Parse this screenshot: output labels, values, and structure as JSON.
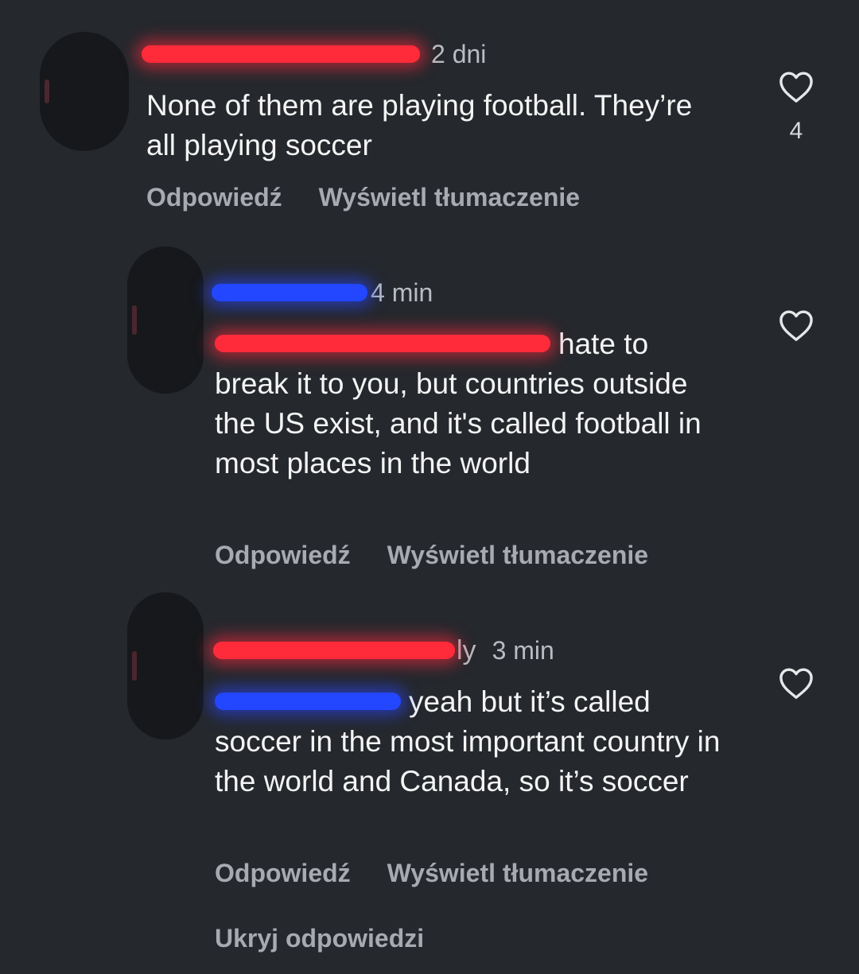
{
  "comments": [
    {
      "username_redacted": true,
      "time": "2 dni",
      "text": "None of them are playing football. They’re all playing soccer",
      "reply_label": "Odpowiedź",
      "translate_label": "Wyświetl tłumaczenie",
      "likes": "4"
    },
    {
      "username_redacted": true,
      "time": "4 min",
      "mention_redacted": true,
      "text": "hate to break it to you, but countries outside the US exist, and it's called football in most places in the world",
      "reply_label": "Odpowiedź",
      "translate_label": "Wyświetl tłumaczenie"
    },
    {
      "username_redacted": true,
      "username_suffix": "ly",
      "time": "3 min",
      "mention_redacted": true,
      "text": "yeah but it’s called soccer in the most important country in the world and Canada, so it’s soccer",
      "reply_label": "Odpowiedź",
      "translate_label": "Wyświetl tłumaczenie"
    }
  ],
  "hide_replies_label": "Ukryj odpowiedzi",
  "colors": {
    "background": "#25282d",
    "redact_red": "#ff2b3a",
    "redact_blue": "#2346ff"
  }
}
